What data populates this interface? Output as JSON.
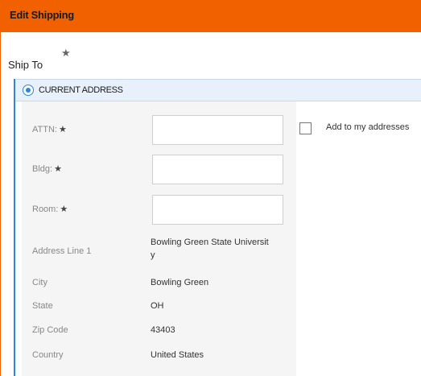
{
  "header": {
    "title": "Edit Shipping"
  },
  "ship_to": {
    "label": "Ship To",
    "required_mark": "★"
  },
  "address_option": {
    "label": "CURRENT ADDRESS",
    "selected": true
  },
  "fields": {
    "attn": {
      "label": "ATTN:",
      "required_mark": "★",
      "value": ""
    },
    "bldg": {
      "label": "Bldg:",
      "required_mark": "★",
      "value": ""
    },
    "room": {
      "label": "Room:",
      "required_mark": "★",
      "value": ""
    }
  },
  "address": {
    "line1": {
      "label": "Address Line 1",
      "value_part1": "Bowling Green State Universit",
      "value_part2": "y"
    },
    "city": {
      "label": "City",
      "value": "Bowling Green"
    },
    "state": {
      "label": "State",
      "value": "OH"
    },
    "zip": {
      "label": "Zip Code",
      "value": "43403"
    },
    "country": {
      "label": "Country",
      "value": "United States"
    }
  },
  "add_to_addresses": {
    "label": "Add to my addresses",
    "checked": false
  },
  "colors": {
    "header": "#f26100",
    "accent": "#2d86d9",
    "panel_bg": "#e8f1fb",
    "form_bg": "#f5f5f5"
  }
}
